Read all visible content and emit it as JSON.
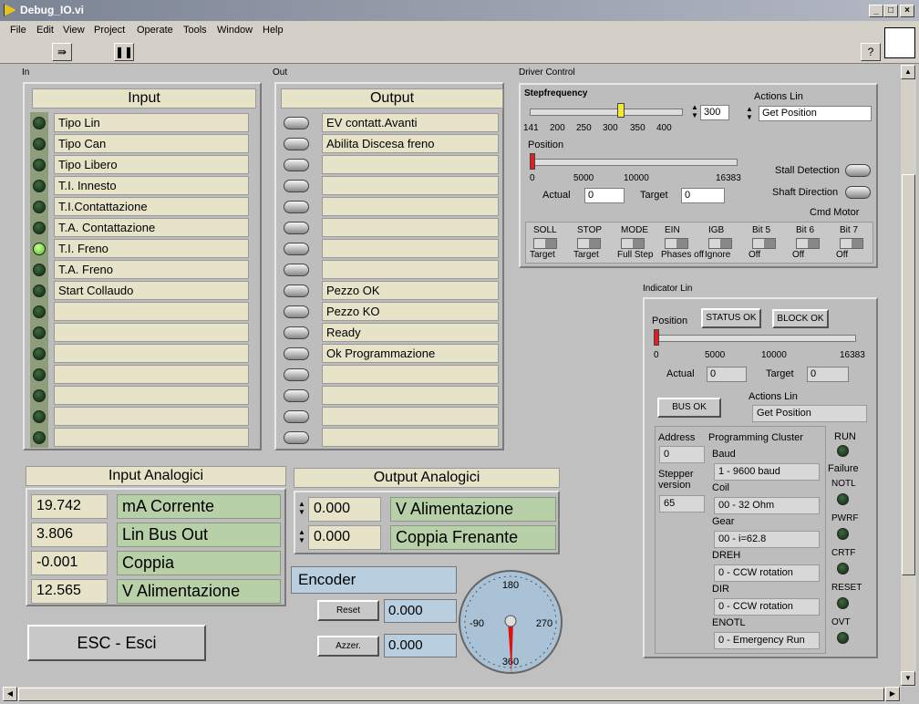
{
  "window": {
    "title": "Debug_IO.vi"
  },
  "menu": [
    "File",
    "Edit",
    "View",
    "Project",
    "Operate",
    "Tools",
    "Window",
    "Help"
  ],
  "sections": {
    "in": "In",
    "out": "Out",
    "driver": "Driver Control",
    "indicator": "Indicator Lin"
  },
  "input": {
    "header": "Input",
    "items": [
      "Tipo Lin",
      "Tipo Can",
      "Tipo Libero",
      "T.I. Innesto",
      "T.I.Contattazione",
      "T.A. Contattazione",
      "T.I. Freno",
      "T.A. Freno",
      "Start Collaudo",
      "",
      "",
      "",
      "",
      "",
      "",
      ""
    ],
    "lit_index": 6
  },
  "output": {
    "header": "Output",
    "items": [
      "EV contatt.Avanti",
      "Abilita Discesa freno",
      "",
      "",
      "",
      "",
      "",
      "",
      "Pezzo OK",
      "Pezzo KO",
      "Ready",
      "Ok Programmazione",
      "",
      "",
      "",
      ""
    ]
  },
  "input_analog": {
    "header": "Input Analogici",
    "values": [
      "19.742",
      "3.806",
      "-0.001",
      "12.565"
    ],
    "labels": [
      "mA Corrente",
      "Lin Bus Out",
      "Coppia",
      "V Alimentazione"
    ]
  },
  "output_analog": {
    "header": "Output Analogici",
    "values": [
      "0.000",
      "0.000"
    ],
    "labels": [
      "V Alimentazione",
      "Coppia Frenante"
    ]
  },
  "encoder": {
    "label": "Encoder",
    "reset": "Reset",
    "reset_val": "0.000",
    "azzer": "Azzer.",
    "azzer_val": "0.000",
    "gauge_labels": [
      "180",
      "270",
      "360",
      "-90"
    ]
  },
  "esc": "ESC - Esci",
  "driver": {
    "stepfreq_label": "Stepfrequency",
    "stepfreq_ticks": [
      "141",
      "200",
      "250",
      "300",
      "350",
      "400"
    ],
    "stepfreq_value": "300",
    "actions_label": "Actions Lin",
    "actions_value": "Get Position",
    "position_label": "Position",
    "position_ticks": [
      "0",
      "5000",
      "10000",
      "16383"
    ],
    "actual_label": "Actual",
    "actual_value": "0",
    "target_label": "Target",
    "target_value": "0",
    "stall": "Stall Detection",
    "shaft": "Shaft Direction",
    "cmd": "Cmd Motor",
    "bits": [
      {
        "top": "SOLL",
        "bot": "Target"
      },
      {
        "top": "STOP",
        "bot": "Target"
      },
      {
        "top": "MODE",
        "bot": "Full Step"
      },
      {
        "top": "EIN",
        "bot": "Phases off"
      },
      {
        "top": "IGB",
        "bot": "Ignore"
      },
      {
        "top": "Bit 5",
        "bot": "Off"
      },
      {
        "top": "Bit 6",
        "bot": "Off"
      },
      {
        "top": "Bit 7",
        "bot": "Off"
      }
    ]
  },
  "indicator": {
    "position_label": "Position",
    "status_btn": "STATUS OK",
    "block_btn": "BLOCK OK",
    "ticks": [
      "0",
      "5000",
      "10000",
      "16383"
    ],
    "actual_label": "Actual",
    "actual_value": "0",
    "target_label": "Target",
    "target_value": "0",
    "bus_btn": "BUS OK",
    "actions_label": "Actions Lin",
    "actions_value": "Get Position",
    "address_label": "Address",
    "address_value": "0",
    "stepper_label": "Stepper version",
    "stepper_value": "65",
    "prog_label": "Programming Cluster",
    "prog": [
      {
        "label": "Baud",
        "value": "1 - 9600 baud"
      },
      {
        "label": "Coil",
        "value": "00 - 32 Ohm"
      },
      {
        "label": "Gear",
        "value": "00 - i=62.8"
      },
      {
        "label": "DREH",
        "value": "0 - CCW rotation"
      },
      {
        "label": "DIR",
        "value": "0 - CCW rotation"
      },
      {
        "label": "ENOTL",
        "value": "0 - Emergency Run"
      }
    ],
    "run": "RUN",
    "failure": "Failure",
    "flags": [
      "NOTL",
      "PWRF",
      "CRTF",
      "RESET",
      "OVT"
    ]
  }
}
